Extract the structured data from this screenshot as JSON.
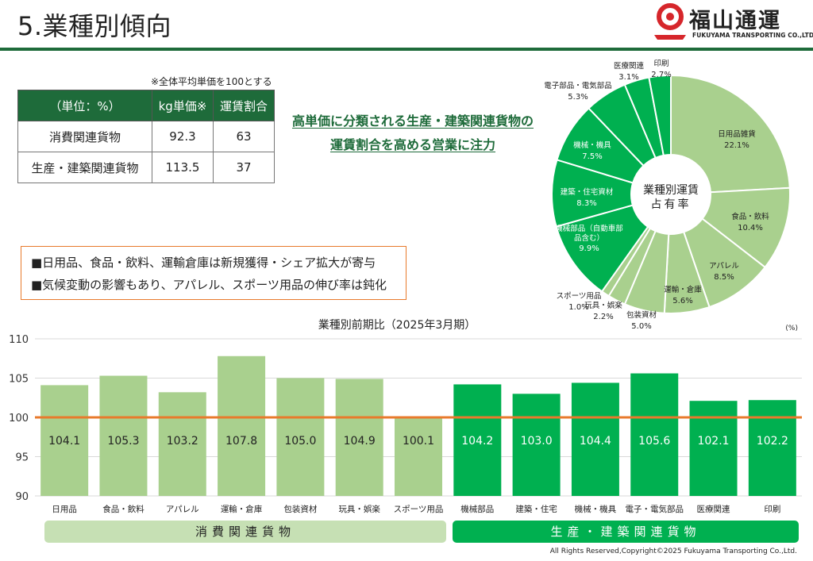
{
  "header": {
    "title": "5.業種別傾向",
    "logo_name": "福山通運",
    "logo_sub": "FUKUYAMA TRANSPORTING CO.,LTD.",
    "accent": "#1e6b3a",
    "logo_red": "#d6262b"
  },
  "unit_table": {
    "note": "※全体平均単価を100とする",
    "headers": [
      "（単位：%）",
      "kg単価※",
      "運賃割合"
    ],
    "rows": [
      {
        "label": "消費関連貨物",
        "kg": "92.3",
        "share": "63"
      },
      {
        "label": "生産・建築関連貨物",
        "kg": "113.5",
        "share": "37"
      }
    ]
  },
  "headline": {
    "line1": "高単価に分類される生産・建築関連貨物の",
    "line2": "運賃割合を高める営業に注力"
  },
  "bullets": {
    "item1": "■日用品、食品・飲料、運輸倉庫は新規獲得・シェア拡大が寄与",
    "item2": "■気候変動の影響もあり、アパレル、スポーツ用品の伸び率は鈍化"
  },
  "pie_center": {
    "line1": "業種別運賃",
    "line2": "占有率"
  },
  "category_bars": {
    "consumer": "消費関連貨物",
    "industrial": "生産・建築関連貨物"
  },
  "copyright": "All Rights Reserved,Copyright©2025 Fukuyama Transporting Co.,Ltd.",
  "chart_data": [
    {
      "type": "pie",
      "title": "業種別運賃占有率",
      "colors": {
        "consumer": "#a9d08e",
        "industrial": "#00b050"
      },
      "slices": [
        {
          "label": "日用品雑貨",
          "value": 22.1,
          "group": "consumer",
          "value_label": "22.1%"
        },
        {
          "label": "食品・飲料",
          "value": 10.4,
          "group": "consumer",
          "value_label": "10.4%"
        },
        {
          "label": "アパレル",
          "value": 8.5,
          "group": "consumer",
          "value_label": "8.5%"
        },
        {
          "label": "運輸・倉庫",
          "value": 5.6,
          "group": "consumer",
          "value_label": "5.6%"
        },
        {
          "label": "包装資材",
          "value": 5.0,
          "group": "consumer",
          "value_label": "5.0%"
        },
        {
          "label": "玩具・娯楽",
          "value": 2.2,
          "group": "consumer",
          "value_label": "2.2%"
        },
        {
          "label": "スポーツ用品",
          "value": 1.0,
          "group": "consumer",
          "value_label": "1.0%"
        },
        {
          "label": "機械部品（自動車部品含む）",
          "value": 9.9,
          "group": "industrial",
          "value_label": "9.9%"
        },
        {
          "label": "建築・住宅資材",
          "value": 8.3,
          "group": "industrial",
          "value_label": "8.3%"
        },
        {
          "label": "機械・機具",
          "value": 7.5,
          "group": "industrial",
          "value_label": "7.5%"
        },
        {
          "label": "電子部品・電気部品",
          "value": 5.3,
          "group": "industrial",
          "value_label": "5.3%"
        },
        {
          "label": "医療関連",
          "value": 3.1,
          "group": "industrial",
          "value_label": "3.1%"
        },
        {
          "label": "印刷",
          "value": 2.7,
          "group": "industrial",
          "value_label": "2.7%"
        }
      ]
    },
    {
      "type": "bar",
      "title": "業種別前期比（2025年3月期）",
      "unit_label": "(%)",
      "ylim": [
        90,
        110
      ],
      "yticks": [
        90,
        95,
        100,
        105,
        110
      ],
      "reference_line": 100,
      "reference_color": "#e87a2c",
      "colors": {
        "consumer": "#a9d08e",
        "industrial": "#00b050"
      },
      "categories": [
        "日用品",
        "食品・飲料",
        "アパレル",
        "運輸・倉庫",
        "包装資材",
        "玩具・娯楽",
        "スポーツ用品",
        "機械部品",
        "建築・住宅",
        "機械・機具",
        "電子・電気部品",
        "医療関連",
        "印刷"
      ],
      "values": [
        104.1,
        105.3,
        103.2,
        107.8,
        105.0,
        104.9,
        100.1,
        104.2,
        103.0,
        104.4,
        105.6,
        102.1,
        102.2
      ],
      "value_labels": [
        "104.1",
        "105.3",
        "103.2",
        "107.8",
        "105.0",
        "104.9",
        "100.1",
        "104.2",
        "103.0",
        "104.4",
        "105.6",
        "102.1",
        "102.2"
      ],
      "groups": [
        "consumer",
        "consumer",
        "consumer",
        "consumer",
        "consumer",
        "consumer",
        "consumer",
        "industrial",
        "industrial",
        "industrial",
        "industrial",
        "industrial",
        "industrial"
      ]
    }
  ]
}
